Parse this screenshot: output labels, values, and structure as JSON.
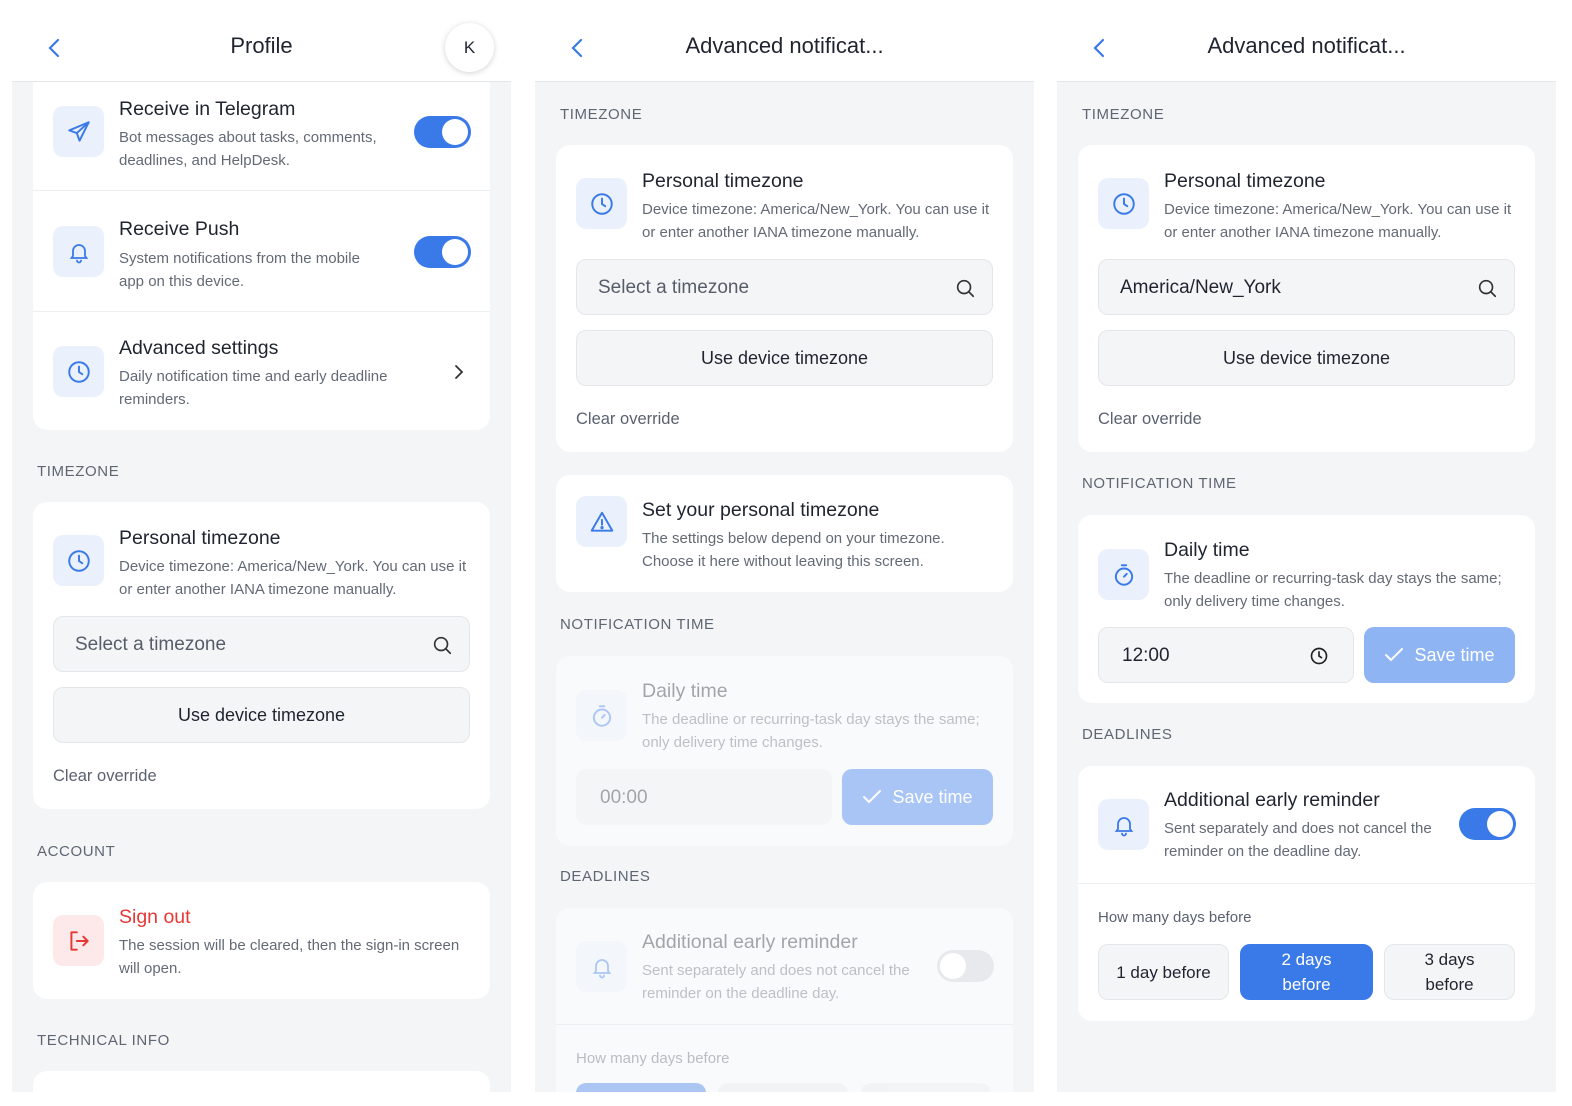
{
  "profile": {
    "title": "Profile",
    "avatar_initial": "K",
    "telegram": {
      "title": "Receive in Telegram",
      "desc_line1": "Bot messages about tasks, comments,",
      "desc_line2": "deadlines, and HelpDesk.",
      "enabled": true
    },
    "push": {
      "title": "Receive Push",
      "desc_line1": "System notifications from the mobile",
      "desc_line2": "app on this device.",
      "enabled": true
    },
    "advanced": {
      "title": "Advanced settings",
      "desc_line1": "Daily notification time and early deadline",
      "desc_line2": "reminders."
    },
    "timezone_section": "TIMEZONE",
    "timezone": {
      "title": "Personal timezone",
      "desc_line1": "Device timezone: America/New_York. You can use it",
      "desc_line2": "or enter another IANA timezone manually.",
      "placeholder": "Select a timezone",
      "device_button": "Use device timezone",
      "clear": "Clear override"
    },
    "account_section": "ACCOUNT",
    "signout": {
      "title": "Sign out",
      "desc_line1": "The session will be cleared, then the sign-in screen",
      "desc_line2": "will open."
    },
    "tech_section": "TECHNICAL INFO"
  },
  "advanced_empty": {
    "title": "Advanced notificat...",
    "timezone_section": "TIMEZONE",
    "timezone": {
      "title": "Personal timezone",
      "desc_line1": "Device timezone: America/New_York. You can use it",
      "desc_line2": "or enter another IANA timezone manually.",
      "placeholder": "Select a timezone",
      "device_button": "Use device timezone",
      "clear": "Clear override"
    },
    "warning": {
      "title": "Set your personal timezone",
      "desc_line1": "The settings below depend on your timezone.",
      "desc_line2": "Choose it here without leaving this screen."
    },
    "notif_section": "NOTIFICATION TIME",
    "daily": {
      "title": "Daily time",
      "desc_line1": "The deadline or recurring-task day stays the same;",
      "desc_line2": "only delivery time changes.",
      "time_value": "00:00",
      "save_label": "Save time"
    },
    "deadlines_section": "DEADLINES",
    "reminder": {
      "title": "Additional early reminder",
      "desc_line1": "Sent separately and does not cancel the",
      "desc_line2": "reminder on the deadline day.",
      "enabled": false,
      "how_many": "How many days before"
    }
  },
  "advanced_filled": {
    "title": "Advanced notificat...",
    "timezone_section": "TIMEZONE",
    "timezone": {
      "title": "Personal timezone",
      "desc_line1": "Device timezone: America/New_York. You can use it",
      "desc_line2": "or enter another IANA timezone manually.",
      "value": "America/New_York",
      "device_button": "Use device timezone",
      "clear": "Clear override"
    },
    "notif_section": "NOTIFICATION TIME",
    "daily": {
      "title": "Daily time",
      "desc_line1": "The deadline or recurring-task day stays the same;",
      "desc_line2": "only delivery time changes.",
      "time_value": "12:00",
      "save_label": "Save time"
    },
    "deadlines_section": "DEADLINES",
    "reminder": {
      "title": "Additional early reminder",
      "desc_line1": "Sent separately and does not cancel the",
      "desc_line2": "reminder on the deadline day.",
      "enabled": true,
      "how_many": "How many days before"
    },
    "days_options": [
      {
        "line1": "1 day before",
        "line2": "",
        "selected": false
      },
      {
        "line1": "2 days",
        "line2": "before",
        "selected": true
      },
      {
        "line1": "3 days",
        "line2": "before",
        "selected": false
      }
    ]
  },
  "colors": {
    "accent": "#3a7ae8",
    "accent_light": "#8fb4f4",
    "danger": "#e53935",
    "background": "#f4f5f7"
  },
  "icons": [
    "chevron-left-icon",
    "send-icon",
    "bell-icon",
    "clock-icon",
    "chevron-right-icon",
    "search-icon",
    "logout-icon",
    "warning-icon",
    "stopwatch-icon",
    "check-icon"
  ]
}
